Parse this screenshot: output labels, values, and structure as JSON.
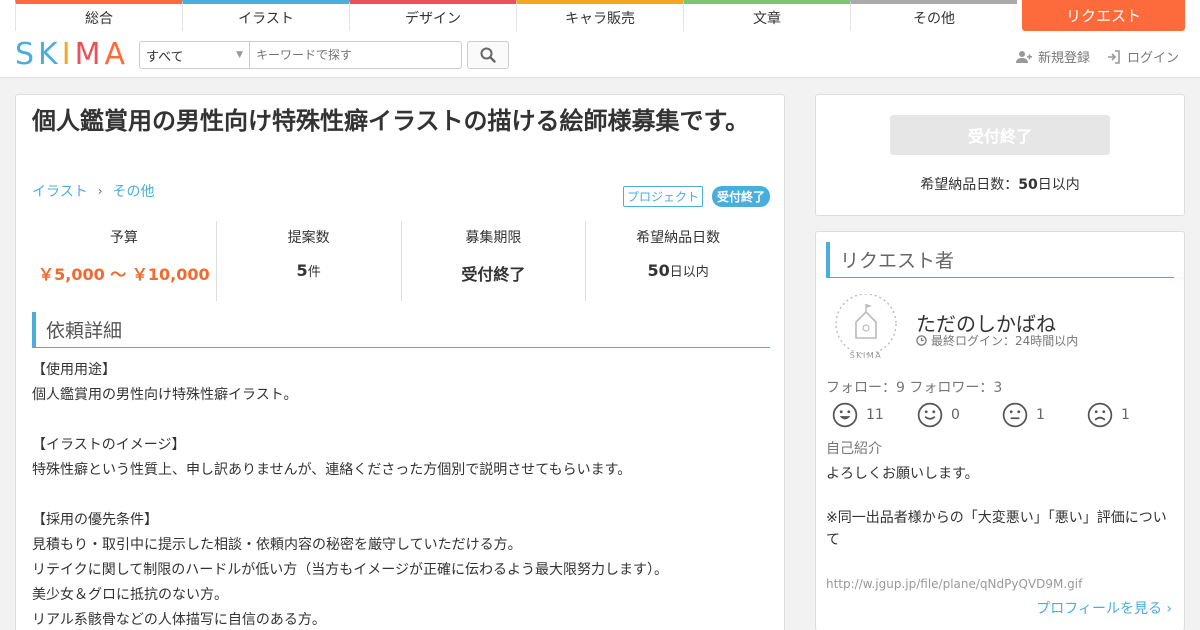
{
  "nav": {
    "categories": [
      {
        "label": "総合",
        "color": "#fd6b3c"
      },
      {
        "label": "イラスト",
        "color": "#4aaddc"
      },
      {
        "label": "デザイン",
        "color": "#e8525c"
      },
      {
        "label": "キャラ販売",
        "color": "#f5a623"
      },
      {
        "label": "文章",
        "color": "#7cc576"
      },
      {
        "label": "その他",
        "color": "#aaaaaa"
      }
    ],
    "request_label": "リクエスト"
  },
  "header": {
    "logo_letters": [
      {
        "ch": "S",
        "color": "#4aaddc"
      },
      {
        "ch": "K",
        "color": "#4aaddc"
      },
      {
        "ch": "I",
        "color": "#f5a623"
      },
      {
        "ch": "M",
        "color": "#e8525c"
      },
      {
        "ch": "A",
        "color": "#fd6b3c"
      }
    ],
    "select_value": "すべて",
    "search_placeholder": "キーワードで探す",
    "register_label": "新規登録",
    "login_label": "ログイン"
  },
  "request": {
    "title": "個人鑑賞用の男性向け特殊性癖イラストの描ける絵師様募集です。",
    "breadcrumb": [
      "イラスト",
      "その他"
    ],
    "tag_project": "プロジェクト",
    "tag_status": "受付終了",
    "stats": {
      "budget_label": "予算",
      "budget_value": "￥5,000 〜 ￥10,000",
      "proposals_label": "提案数",
      "proposals_num": "5",
      "proposals_unit": "件",
      "deadline_label": "募集期限",
      "deadline_value": "受付終了",
      "delivery_label": "希望納品日数",
      "delivery_num": "50",
      "delivery_unit": "日以内"
    },
    "detail_heading": "依頼詳細",
    "detail_lines": [
      "【使用用途】",
      "個人鑑賞用の男性向け特殊性癖イラスト。",
      "",
      "【イラストのイメージ】",
      "特殊性癖という性質上、申し訳ありませんが、連絡くださった方個別で説明させてもらいます。",
      "",
      "【採用の優先条件】",
      "見積もり・取引中に提示した相談・依頼内容の秘密を厳守していただける方。",
      "リテイクに関して制限のハードルが低い方（当方もイメージが正確に伝わるよう最大限努力します）。",
      "美少女＆グロに抵抗のない方。",
      "リアル系骸骨などの人体描写に自信のある方。"
    ]
  },
  "sidebar": {
    "closed_button": "受付終了",
    "delivery_prefix": "希望納品日数：",
    "delivery_num": "50",
    "delivery_unit": "日以内",
    "requester_heading": "リクエスト者",
    "avatar_text": "SKIMA",
    "user_name": "ただのしかばね",
    "last_login": "最終ログイン：24時間以内",
    "follow_text": "フォロー：9 フォロワー：3",
    "ratings": [
      {
        "icon": "very-good-face-icon",
        "count": "11"
      },
      {
        "icon": "good-face-icon",
        "count": "0"
      },
      {
        "icon": "bad-face-icon",
        "count": "1"
      },
      {
        "icon": "very-bad-face-icon",
        "count": "1"
      }
    ],
    "intro_heading": "自己紹介",
    "intro_lines": [
      "よろしくお願いします。",
      "",
      "※同一出品者様からの「大変悪い」「悪い」評価について",
      ""
    ],
    "intro_link": "http://w.jgup.jp/file/plane/qNdPyQVD9M.gif",
    "more_label": "プロフィールを見る ›"
  }
}
